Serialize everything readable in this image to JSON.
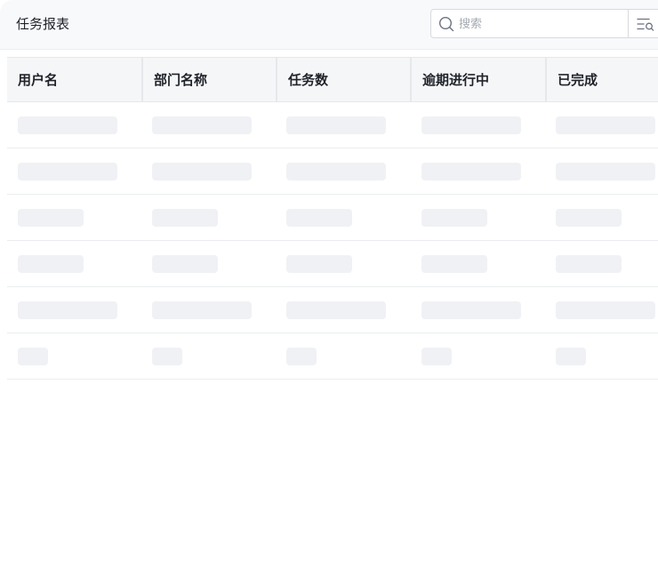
{
  "header": {
    "title": "任务报表",
    "search": {
      "placeholder": "搜索",
      "value": ""
    },
    "icons": {
      "search": "search-icon",
      "filter": "filter-icon"
    }
  },
  "table": {
    "columns": [
      {
        "label": "用户名"
      },
      {
        "label": "部门名称"
      },
      {
        "label": "任务数"
      },
      {
        "label": "逾期进行中"
      },
      {
        "label": "已完成"
      }
    ],
    "loading_rows": 6
  },
  "colors": {
    "header_bg": "#f8f9fb",
    "table_header_bg": "#f5f6f8",
    "skeleton": "#f0f1f4",
    "border": "#e5e7eb",
    "text": "#1f2329",
    "placeholder": "#a5aab3"
  }
}
